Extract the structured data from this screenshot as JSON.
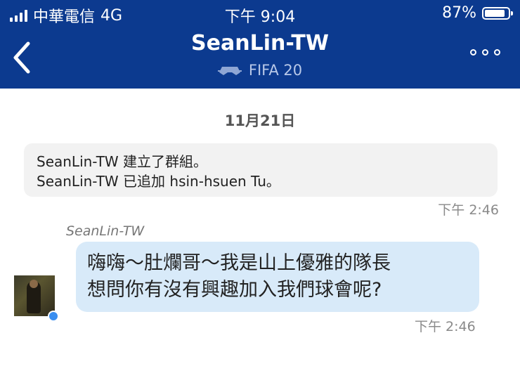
{
  "status_bar": {
    "carrier": "中華電信",
    "network": "4G",
    "time": "下午 9:04",
    "battery": "87%",
    "battery_level": 0.87
  },
  "header": {
    "title": "SeanLin-TW",
    "subtitle": "FIFA 20",
    "back_icon": "chevron-left-icon",
    "more_icon": "more-dots-icon",
    "background": "#0c3a8f"
  },
  "chat": {
    "date": "11月21日",
    "system_messages": [
      "SeanLin-TW 建立了群組。",
      "SeanLin-TW 已追加 hsin-hsuen Tu。"
    ],
    "system_time": "下午 2:46",
    "sender": "SeanLin-TW",
    "message_lines": [
      "嗨嗨～肚爛哥～我是山上優雅的隊長",
      "想問你有沒有興趣加入我們球會呢?"
    ],
    "message_time": "下午 2:46",
    "bubble_color": "#d8eaf9",
    "online_color": "#3a8ef0"
  }
}
